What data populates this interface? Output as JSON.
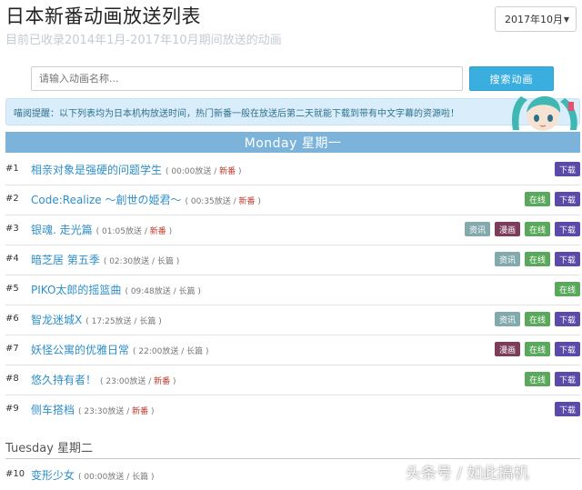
{
  "page": {
    "title": "日本新番动画放送列表",
    "subtitle": "目前已收录2014年1月-2017年10月期间放送的动画"
  },
  "month_select": {
    "value": "2017年10月"
  },
  "search": {
    "placeholder": "请输入动画名称...",
    "button": "搜索动画"
  },
  "notice": "喵阅提醒：以下列表均为日本机构放送时间，热门新番一般在放送后第二天就能下载到带有中文字幕的资源啦！",
  "colors": {
    "accent": "#3aaedf",
    "day_header": "#7bb3da",
    "title_link": "#2e8fc9",
    "tag_info": "#82a9ac",
    "tag_manga": "#7c3d5a",
    "tag_online": "#5aa85c",
    "tag_download": "#5b4aa7",
    "new": "#c0392b"
  },
  "tag_labels": {
    "info": "资讯",
    "manga": "漫画",
    "online": "在线",
    "download": "下载"
  },
  "days": [
    {
      "label": "Monday 星期一"
    },
    {
      "label": "Tuesday 星期二"
    }
  ],
  "rows": [
    {
      "num": "#1",
      "title": "相亲对象是强硬的问题学生",
      "time": "00:00放送",
      "kind": "新番",
      "is_new": true,
      "tags": [
        "download"
      ]
    },
    {
      "num": "#2",
      "title": "Code:Realize ～創世の姫君～",
      "time": "00:35放送",
      "kind": "新番",
      "is_new": true,
      "tags": [
        "online",
        "download"
      ]
    },
    {
      "num": "#3",
      "title": "银魂. 走光篇",
      "time": "01:05放送",
      "kind": "新番",
      "is_new": true,
      "tags": [
        "info",
        "manga",
        "online",
        "download"
      ]
    },
    {
      "num": "#4",
      "title": "暗芝居 第五季",
      "time": "02:30放送",
      "kind": "长篇",
      "is_new": false,
      "tags": [
        "info",
        "online",
        "download"
      ]
    },
    {
      "num": "#5",
      "title": "PIKO太郎的摇篮曲",
      "time": "09:48放送",
      "kind": "长篇",
      "is_new": false,
      "tags": [
        "online"
      ]
    },
    {
      "num": "#6",
      "title": "智龙迷城X",
      "time": "17:25放送",
      "kind": "长篇",
      "is_new": false,
      "tags": [
        "info",
        "online",
        "download"
      ]
    },
    {
      "num": "#7",
      "title": "妖怪公寓的优雅日常",
      "time": "22:00放送",
      "kind": "长篇",
      "is_new": false,
      "tags": [
        "manga",
        "online",
        "download"
      ]
    },
    {
      "num": "#8",
      "title": "悠久持有者！",
      "time": "23:00放送",
      "kind": "新番",
      "is_new": true,
      "tags": [
        "online",
        "download"
      ]
    },
    {
      "num": "#9",
      "title": "侧车搭档",
      "time": "23:30放送",
      "kind": "新番",
      "is_new": true,
      "tags": [
        "download"
      ]
    },
    {
      "num": "#10",
      "title": "变形少女",
      "time": "00:00放送",
      "kind": "长篇",
      "is_new": false,
      "tags": []
    }
  ],
  "watermark": "头条号 / 如此搞机"
}
